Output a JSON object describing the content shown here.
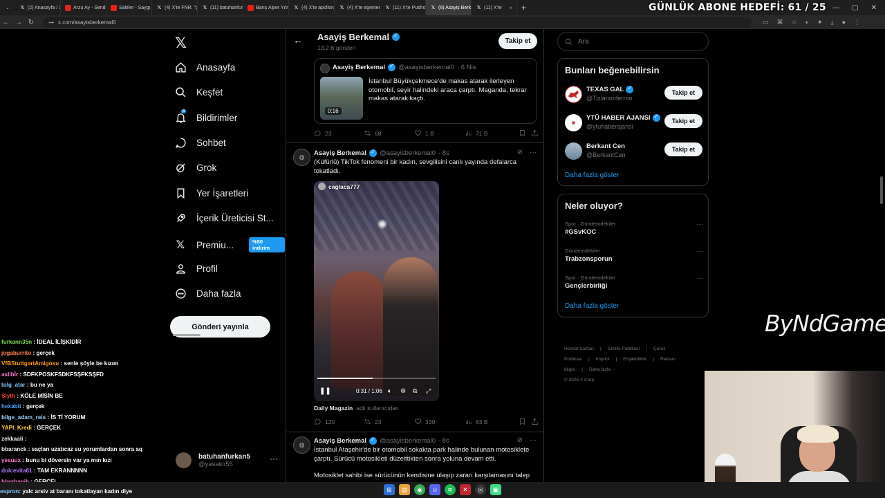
{
  "browser": {
    "tabs": [
      {
        "label": "(2) Anasayfa / X",
        "icon": "x"
      },
      {
        "label": "Arzu Ay - Sende Un",
        "icon": "yt"
      },
      {
        "label": "Sakiler - Saygı",
        "icon": "yt"
      },
      {
        "label": "(4) X'te FNR: \"gere",
        "icon": "x"
      },
      {
        "label": "(11) batuhanfurkan",
        "icon": "x"
      },
      {
        "label": "Barış Alper Yılmaz",
        "icon": "yt"
      },
      {
        "label": "(4) X'te apollons \"e",
        "icon": "x"
      },
      {
        "label": "(4) X'te egemen \"b",
        "icon": "x"
      },
      {
        "label": "(11) X'te Pusholder",
        "icon": "x"
      },
      {
        "label": "(8) Asayiş Berke",
        "icon": "x",
        "active": true
      },
      {
        "label": "(11) X'te",
        "icon": "x"
      }
    ],
    "url": "x.com/asayisberkemal0",
    "goal_overlay": "GÜNLÜK ABONE HEDEFİ: 61 / 25"
  },
  "sidenav": {
    "items": [
      {
        "label": "Anasayfa",
        "icon": "home-icon"
      },
      {
        "label": "Keşfet",
        "icon": "search-icon"
      },
      {
        "label": "Bildirimler",
        "icon": "bell-icon",
        "badge": "8"
      },
      {
        "label": "Sohbet",
        "icon": "chat-icon"
      },
      {
        "label": "Grok",
        "icon": "grok-icon"
      },
      {
        "label": "Yer İşaretleri",
        "icon": "bookmark-icon"
      },
      {
        "label": "İçerik Üreticisi St...",
        "icon": "rocket-icon"
      },
      {
        "label": "Premiu...",
        "icon": "x-icon"
      },
      {
        "label": "Profil",
        "icon": "person-icon"
      },
      {
        "label": "Daha fazla",
        "icon": "more-circle-icon"
      }
    ],
    "premium_badge": "%50 indirim",
    "post_button": "Gönderi yayınla",
    "account": {
      "name": "batuhanfurkan5",
      "handle": "@yasaklı55"
    }
  },
  "profile_header": {
    "name": "Asayiş Berkemal",
    "post_count": "13,2 B gönderi",
    "follow": "Takip et"
  },
  "quoted_tweet": {
    "author": "Asayiş Berkemal",
    "handle": "@asayisberkemal0",
    "time": "· 6 Nis",
    "duration": "0:16",
    "text": "İstanbul Büyükçekmece'de makas atarak ilerleyen otomobil, seyir halindeki araca çarptı. Maganda, tekrar makas atarak kaçtı."
  },
  "actions1": {
    "reply": "23",
    "retweet": "68",
    "like": "1 B",
    "views": "71 B"
  },
  "tweet2": {
    "author": "Asayiş Berkemal",
    "handle": "@asayisberkemal0",
    "time": "· 8s",
    "text": "(Küfürlü) TikTok fenomeni bir kadın, sevgilisini canlı yayında defalarca tokatladı.",
    "video_user": "caglaca777",
    "video_time": "0:31 / 1:06",
    "video_progress": 0.47,
    "source_name": "Daily Magazin",
    "source_note": "adlı kullanıcıdan"
  },
  "actions2": {
    "reply": "120",
    "retweet": "23",
    "like": "330",
    "views": "63 B"
  },
  "tweet3": {
    "author": "Asayiş Berkemal",
    "handle": "@asayisberkemal0",
    "time": "· 8s",
    "text": "İstanbul Ataşehir'de bir otomobil sokakta park halinde bulunan motosiklete çarptı. Sürücü motosikleti düzelttikten sonra yoluna devam etti.",
    "text2": "Motosiklet sahibi ise sürücünün kendisine ulaşıp zararı karşılamasını talep"
  },
  "right": {
    "search_placeholder": "Ara",
    "who_title": "Bunları beğenebilirsin",
    "who": [
      {
        "name": "TEXAS GAL",
        "handle": "@Tizianooferroo",
        "verified": true,
        "button": "Takip et",
        "color": "#c0262d"
      },
      {
        "name": "YTÜ HABER AJANSI",
        "handle": "@ytuhaberajansi",
        "verified": true,
        "button": "Takip et",
        "color": "#ffffff"
      },
      {
        "name": "Berkant Cen",
        "handle": "@BerkantCen",
        "verified": false,
        "button": "Takip et",
        "color": "#8aa3b8"
      }
    ],
    "show_more": "Daha fazla göster",
    "trends_title": "Neler oluyor?",
    "trends": [
      {
        "category": "Spor · Gündemdekiler",
        "name": "#GSvKOC"
      },
      {
        "category": "Gündemdekiler",
        "name": "Trabzonsporun"
      },
      {
        "category": "Spor · Gündemdekiler",
        "name": "Gençlerbirliği"
      }
    ],
    "show_more2": "Daha fazla göster",
    "footer": [
      "Hizmet Şartları",
      "|",
      "Gizlilik Politikası",
      "|",
      "Çerez Politikası",
      "|",
      "Imprint",
      "|",
      "Erişilebilirlik",
      "|",
      "Reklam bilgisi",
      "|",
      "Daha fazla ···",
      "© 2026 X Corp."
    ]
  },
  "stream": {
    "brand": "ByNdGame",
    "chat": [
      {
        "user": "furkann35n",
        "msg": ": İDEAL İLİŞKİDİR",
        "color": "#7cd957"
      },
      {
        "user": "jogaburrito",
        "msg": ": gerçek",
        "color": "#ff7f50"
      },
      {
        "user": "VfBStuttgartAmigosu",
        "msg": ": senle şöyle be kızım",
        "color": "#ff9f1a"
      },
      {
        "user": "aslibİr",
        "msg": ": SDFKPOSKFSDKFSŞFKSŞFD",
        "color": "#ff7bd2"
      },
      {
        "user": "tolg_atar",
        "msg": ": bu ne ya",
        "color": "#7fc9ff"
      },
      {
        "user": "Slyth",
        "msg": ": KÖLE MİSİN BE",
        "color": "#ff3b3b"
      },
      {
        "user": "hexabit",
        "msg": ": gerçek",
        "color": "#4aa3ff"
      },
      {
        "user": "bilge_adam_reis",
        "msg": ": İS Tİ YORUM",
        "color": "#9fd3ff"
      },
      {
        "user": "YAPI_Kredi",
        "msg": ": GERÇEK",
        "color": "#ffd23f"
      },
      {
        "user": "zekkaali",
        "msg": ":",
        "color": "#e7e9ea"
      },
      {
        "user": "bbaranck",
        "msg": ": saçları uzatıcaz su yorumlardan sonra aq",
        "color": "#e7e9ea"
      },
      {
        "user": "yesuux",
        "msg": ": bunu bi döversin var ya mın kızı",
        "color": "#ff7bd2"
      },
      {
        "user": "dolcevita61",
        "msg": ": TAM EKRANNNNN",
        "color": "#b07cff"
      },
      {
        "user": "bburhanjh",
        "msg": ": GERÇEL",
        "color": "#ff7bd2"
      }
    ],
    "chat_bottom": {
      "user": "espron",
      "msg": ": yalc arsiv at baranı tokatlayan kadın diye",
      "color": "#7fc9ff"
    }
  }
}
